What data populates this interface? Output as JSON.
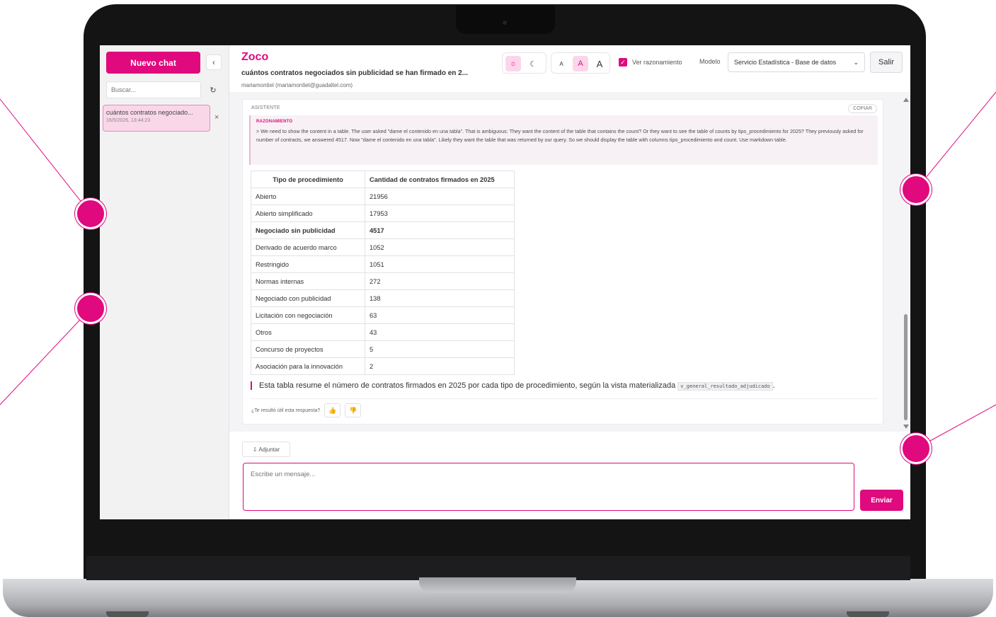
{
  "sidebar": {
    "new_chat_label": "Nuevo chat",
    "collapse_icon": "‹",
    "search_placeholder": "Buscar...",
    "refresh_icon": "↻",
    "conversations": [
      {
        "title": "cuántos contratos negociado...",
        "date": "16/5/2026, 13:44:23"
      }
    ],
    "delete_icon": "×"
  },
  "header": {
    "app_title": "Zoco",
    "chat_title": "cuántos contratos negociados sin publicidad se han firmado en 2...",
    "user": "mariamontiel (mariamontiel@guadaltel.com)",
    "theme": {
      "light_icon": "☼",
      "dark_icon": "☾"
    },
    "font_sizes": [
      "A",
      "A",
      "A"
    ],
    "reasoning_toggle": {
      "label": "Ver razonamiento",
      "checked": true,
      "check_icon": "✓"
    },
    "model_label": "Modelo",
    "model_value": "Servicio Estadística - Base de datos",
    "model_chevron": "⌄",
    "logout_label": "Salir"
  },
  "message": {
    "role": "ASISTENTE",
    "copy_label": "COPIAR",
    "reasoning_title": "RAZONAMIENTO",
    "reasoning_text": "> We need to show the content in a table. The user asked \"dame el contenido en una tabla\". That is ambiguous: They want the content of the table that contains the count? Or they want to see the table of counts by tipo_procedimiento for 2025? They previously asked for number of contracts, we answered 4517. Now \"dame el contenido en una tabla\". Likely they want the table that was returned by our query. So we should display the table with columns tipo_procedimiento and count. Use markdown table.",
    "table": {
      "headers": [
        "Tipo de procedimiento",
        "Cantidad de contratos firmados en 2025"
      ],
      "rows": [
        [
          "Abierto",
          "21956"
        ],
        [
          "Abierto simplificado",
          "17953"
        ],
        [
          "Negociado sin publicidad",
          "4517"
        ],
        [
          "Derivado de acuerdo marco",
          "1052"
        ],
        [
          "Restringido",
          "1051"
        ],
        [
          "Normas internas",
          "272"
        ],
        [
          "Negociado con publicidad",
          "138"
        ],
        [
          "Licitación con negociación",
          "63"
        ],
        [
          "Otros",
          "43"
        ],
        [
          "Concurso de proyectos",
          "5"
        ],
        [
          "Asociación para la innovación",
          "2"
        ]
      ]
    },
    "summary_text": "Esta tabla resume el número de contratos firmados en 2025 por cada tipo de procedimiento, según la vista materializada",
    "summary_code": "v_general_resultado_adjudicado",
    "summary_end": ".",
    "feedback_question": "¿Te resultó útil esta respuesta?",
    "thumbs_up_icon": "👍",
    "thumbs_down_icon": "👎"
  },
  "composer": {
    "attach_label": "⇩ Adjuntar",
    "placeholder": "Escribe un mensaje...",
    "send_label": "Enviar"
  },
  "colors": {
    "accent": "#e0097e",
    "accent_light": "#fbd6ea"
  }
}
